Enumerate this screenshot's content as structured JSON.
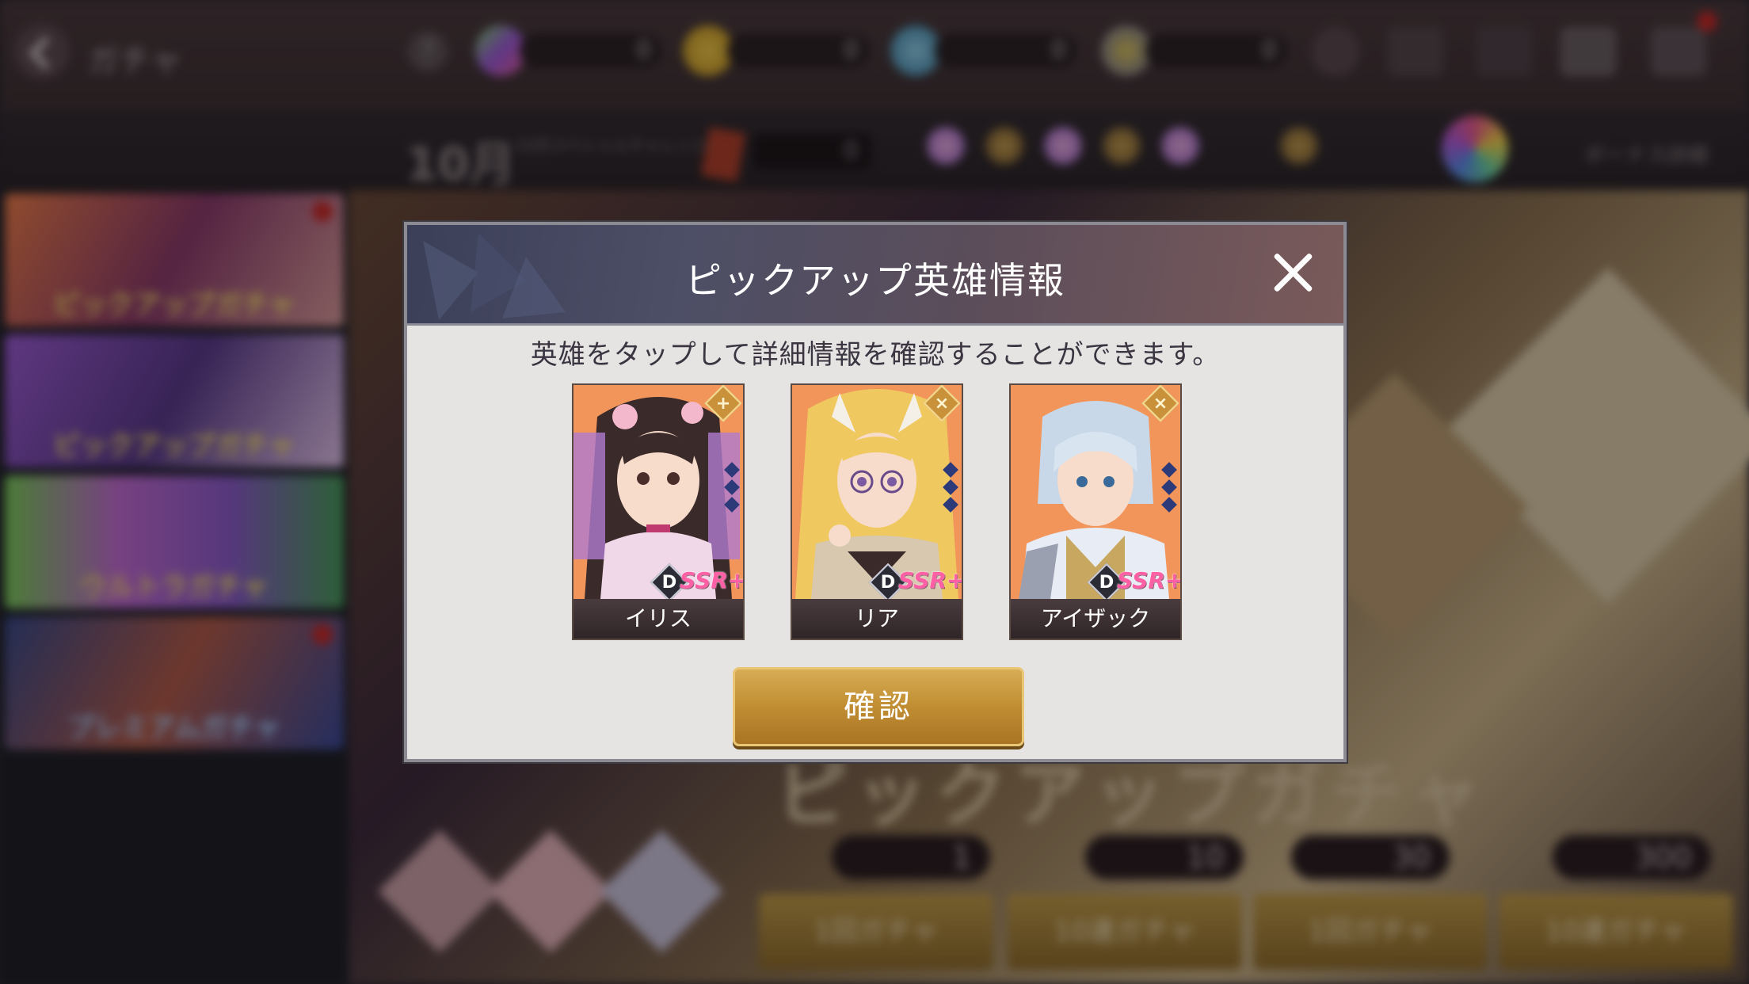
{
  "topbar": {
    "title": "ガチャ",
    "currencies": [
      {
        "name": "rainbow-crystal",
        "value": "0"
      },
      {
        "name": "gold",
        "value": "0"
      },
      {
        "name": "dragon-token",
        "value": "0"
      },
      {
        "name": "medal",
        "value": "0"
      }
    ]
  },
  "infobar": {
    "month": "10月",
    "sub": "10月スペシャルチャレンジ",
    "ticket_count": "0",
    "detail_label": "ボーナス詳細"
  },
  "sidebar": {
    "banners": [
      {
        "label": "ピックアップガチャ"
      },
      {
        "label": "ピックアップガチャ"
      },
      {
        "label": "ウルトラガチャ"
      },
      {
        "label": "プレミアムガチャ"
      }
    ]
  },
  "background": {
    "headline": "ピックアップガチャ",
    "pulls": [
      {
        "count": "1",
        "label": "1回ガチャ"
      },
      {
        "count": "10",
        "label": "10連ガチャ"
      },
      {
        "count": "30",
        "label": "1回ガチャ"
      },
      {
        "count": "300",
        "label": "10連ガチャ"
      }
    ]
  },
  "dialog": {
    "title": "ピックアップ英雄情報",
    "message": "英雄をタップして詳細情報を確認することができます。",
    "confirm_label": "確認",
    "heroes": [
      {
        "name": "イリス",
        "rank": "D",
        "rarity": "SSR+",
        "class_symbol": "+"
      },
      {
        "name": "リア",
        "rank": "D",
        "rarity": "SSR+",
        "class_symbol": "×"
      },
      {
        "name": "アイザック",
        "rank": "D",
        "rarity": "SSR+",
        "class_symbol": "×"
      }
    ]
  },
  "colors": {
    "accent_gold": "#c18d32",
    "card_orange": "#f08a4a",
    "dialog_bg": "#e6e3e3",
    "header_blue": "#3b3f58"
  }
}
